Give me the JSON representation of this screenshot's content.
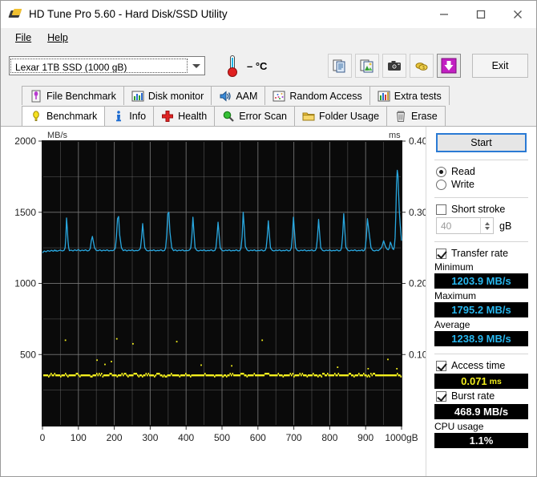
{
  "window": {
    "title": "HD Tune Pro 5.60 - Hard Disk/SSD Utility",
    "icon": "hdtune-logo-icon",
    "controls": {
      "minimize": "−",
      "maximize": "□",
      "close": "✕"
    }
  },
  "menu": {
    "items": [
      {
        "label": "File"
      },
      {
        "label": "Help"
      }
    ]
  },
  "toolbar": {
    "drive_selected": "Lexar 1TB SSD (1000 gB)",
    "temperature": "– °C",
    "buttons": [
      {
        "name": "copy-text-icon",
        "title": "Copy text"
      },
      {
        "name": "copy-image-icon",
        "title": "Copy image"
      },
      {
        "name": "screenshot-camera-icon",
        "title": "Save screenshot"
      },
      {
        "name": "coins-icon",
        "title": "Donate"
      },
      {
        "name": "download-arrow-icon",
        "title": "Download"
      }
    ],
    "exit_label": "Exit"
  },
  "tabs": {
    "row1": [
      {
        "label": "File Benchmark",
        "icon": "file-benchmark-icon",
        "active": false
      },
      {
        "label": "Disk monitor",
        "icon": "disk-monitor-icon",
        "active": false
      },
      {
        "label": "AAM",
        "icon": "speaker-icon",
        "active": false
      },
      {
        "label": "Random Access",
        "icon": "random-access-icon",
        "active": false
      },
      {
        "label": "Extra tests",
        "icon": "extra-tests-icon",
        "active": false
      }
    ],
    "row2": [
      {
        "label": "Benchmark",
        "icon": "lightbulb-icon",
        "active": true
      },
      {
        "label": "Info",
        "icon": "info-icon",
        "active": false
      },
      {
        "label": "Health",
        "icon": "health-cross-icon",
        "active": false
      },
      {
        "label": "Error Scan",
        "icon": "magnifier-icon",
        "active": false
      },
      {
        "label": "Folder Usage",
        "icon": "folder-icon",
        "active": false
      },
      {
        "label": "Erase",
        "icon": "trash-icon",
        "active": false
      }
    ]
  },
  "panel": {
    "start_label": "Start",
    "read_label": "Read",
    "write_label": "Write",
    "read_selected": true,
    "write_selected": false,
    "short_stroke_label": "Short stroke",
    "short_stroke_checked": false,
    "short_stroke_value": "40",
    "short_stroke_unit": "gB",
    "transfer_rate_label": "Transfer rate",
    "transfer_rate_checked": true,
    "minimum_label": "Minimum",
    "minimum_value": "1203.9 MB/s",
    "maximum_label": "Maximum",
    "maximum_value": "1795.2 MB/s",
    "average_label": "Average",
    "average_value": "1238.9 MB/s",
    "access_time_label": "Access time",
    "access_time_checked": true,
    "access_time_value": "0.071",
    "access_time_unit": "ms",
    "burst_rate_label": "Burst rate",
    "burst_rate_checked": true,
    "burst_rate_value": "468.9 MB/s",
    "cpu_usage_label": "CPU usage",
    "cpu_usage_value": "1.1%"
  },
  "chart_data": {
    "type": "line",
    "title": "",
    "ylabel": "MB/s",
    "y2label": "ms",
    "xlabel": "gB",
    "xlim": [
      0,
      1000
    ],
    "ylim": [
      0,
      2000
    ],
    "y2lim": [
      0,
      0.4
    ],
    "yticks": [
      500,
      1000,
      1500,
      2000
    ],
    "y2ticks": [
      0.1,
      0.2,
      0.3,
      0.4
    ],
    "xticks": [
      0,
      100,
      200,
      300,
      400,
      500,
      600,
      700,
      800,
      900,
      1000
    ],
    "xtick_labels": [
      "0",
      "100",
      "200",
      "300",
      "400",
      "500",
      "600",
      "700",
      "800",
      "900",
      "1000gB"
    ],
    "grid": true,
    "plot_bg": "#0a0a0a",
    "series": [
      {
        "name": "Transfer rate",
        "color": "#29a8e0",
        "unit": "MB/s",
        "axis": "left",
        "x": [
          0,
          5,
          10,
          15,
          20,
          25,
          30,
          32,
          34,
          36,
          38,
          40,
          45,
          50,
          55,
          60,
          63,
          65,
          67,
          69,
          71,
          73,
          75,
          80,
          85,
          90,
          95,
          100,
          105,
          110,
          115,
          120,
          125,
          130,
          133,
          136,
          139,
          142,
          145,
          150,
          155,
          160,
          165,
          170,
          175,
          180,
          185,
          190,
          195,
          200,
          203,
          206,
          209,
          212,
          215,
          220,
          225,
          230,
          235,
          240,
          245,
          250,
          255,
          260,
          265,
          270,
          273,
          276,
          279,
          282,
          285,
          290,
          295,
          300,
          305,
          310,
          315,
          320,
          325,
          330,
          335,
          340,
          343,
          346,
          349,
          352,
          355,
          360,
          365,
          370,
          375,
          380,
          385,
          390,
          395,
          400,
          405,
          410,
          413,
          416,
          419,
          422,
          425,
          430,
          435,
          440,
          445,
          450,
          455,
          460,
          465,
          470,
          475,
          480,
          483,
          486,
          489,
          492,
          495,
          500,
          505,
          510,
          515,
          520,
          525,
          530,
          535,
          540,
          545,
          550,
          553,
          556,
          559,
          562,
          565,
          570,
          575,
          580,
          585,
          590,
          595,
          600,
          605,
          610,
          615,
          620,
          623,
          626,
          629,
          632,
          635,
          640,
          645,
          650,
          655,
          660,
          665,
          670,
          675,
          680,
          685,
          690,
          693,
          696,
          699,
          702,
          705,
          710,
          715,
          720,
          725,
          730,
          735,
          740,
          745,
          750,
          755,
          760,
          763,
          766,
          769,
          772,
          775,
          780,
          785,
          790,
          795,
          800,
          805,
          810,
          815,
          820,
          825,
          830,
          833,
          836,
          839,
          842,
          845,
          850,
          855,
          860,
          865,
          870,
          875,
          880,
          885,
          890,
          893,
          896,
          899,
          902,
          905,
          910,
          915,
          920,
          925,
          930,
          935,
          940,
          945,
          950,
          955,
          960,
          963,
          966,
          969,
          972,
          975,
          978,
          980,
          982,
          984,
          986,
          988,
          990,
          992,
          994,
          996,
          998,
          1000
        ],
        "y": [
          1215,
          1228,
          1222,
          1231,
          1225,
          1233,
          1226,
          1230,
          1235,
          1228,
          1232,
          1226,
          1230,
          1234,
          1228,
          1232,
          1250,
          1320,
          1460,
          1390,
          1300,
          1250,
          1230,
          1234,
          1228,
          1236,
          1230,
          1238,
          1228,
          1234,
          1230,
          1236,
          1228,
          1232,
          1245,
          1300,
          1330,
          1290,
          1250,
          1232,
          1230,
          1236,
          1228,
          1234,
          1230,
          1236,
          1228,
          1232,
          1230,
          1236,
          1250,
          1330,
          1455,
          1470,
          1340,
          1250,
          1230,
          1236,
          1228,
          1234,
          1230,
          1236,
          1228,
          1232,
          1230,
          1236,
          1250,
          1320,
          1420,
          1330,
          1250,
          1232,
          1228,
          1234,
          1230,
          1236,
          1228,
          1232,
          1230,
          1236,
          1228,
          1232,
          1250,
          1340,
          1490,
          1500,
          1360,
          1250,
          1230,
          1236,
          1228,
          1234,
          1230,
          1236,
          1228,
          1232,
          1230,
          1236,
          1250,
          1330,
          1465,
          1355,
          1250,
          1232,
          1228,
          1234,
          1230,
          1236,
          1228,
          1232,
          1230,
          1236,
          1228,
          1232,
          1250,
          1330,
          1430,
          1340,
          1250,
          1232,
          1228,
          1234,
          1230,
          1236,
          1228,
          1232,
          1230,
          1236,
          1228,
          1232,
          1250,
          1330,
          1500,
          1390,
          1260,
          1235,
          1228,
          1234,
          1230,
          1236,
          1228,
          1232,
          1230,
          1236,
          1228,
          1232,
          1250,
          1330,
          1440,
          1340,
          1250,
          1232,
          1228,
          1234,
          1230,
          1236,
          1228,
          1232,
          1230,
          1236,
          1228,
          1232,
          1250,
          1335,
          1465,
          1360,
          1250,
          1232,
          1228,
          1234,
          1230,
          1236,
          1228,
          1232,
          1230,
          1236,
          1228,
          1232,
          1250,
          1330,
          1450,
          1345,
          1250,
          1232,
          1228,
          1234,
          1230,
          1236,
          1228,
          1232,
          1230,
          1236,
          1228,
          1232,
          1250,
          1340,
          1490,
          1375,
          1255,
          1234,
          1228,
          1234,
          1230,
          1236,
          1228,
          1232,
          1230,
          1236,
          1228,
          1232,
          1250,
          1330,
          1455,
          1350,
          1250,
          1232,
          1228,
          1234,
          1230,
          1240,
          1255,
          1300,
          1260,
          1240,
          1236,
          1250,
          1290,
          1270,
          1245,
          1238,
          1260,
          1320,
          1480,
          1700,
          1795,
          1760,
          1620,
          1500,
          1420,
          1360,
          1300,
          1260,
          1240,
          1230
        ]
      },
      {
        "name": "Access time",
        "color": "#f2ee1d",
        "unit": "ms",
        "axis": "right",
        "marker": "dot",
        "baseline": 0.071,
        "outliers": [
          {
            "x": 62,
            "y": 0.12
          },
          {
            "x": 205,
            "y": 0.122
          },
          {
            "x": 250,
            "y": 0.115
          },
          {
            "x": 150,
            "y": 0.092
          },
          {
            "x": 172,
            "y": 0.086
          },
          {
            "x": 190,
            "y": 0.09
          },
          {
            "x": 372,
            "y": 0.118
          },
          {
            "x": 610,
            "y": 0.12
          },
          {
            "x": 440,
            "y": 0.085
          },
          {
            "x": 525,
            "y": 0.084
          },
          {
            "x": 820,
            "y": 0.082
          },
          {
            "x": 960,
            "y": 0.093
          },
          {
            "x": 905,
            "y": 0.08
          },
          {
            "x": 985,
            "y": 0.08
          }
        ]
      }
    ]
  }
}
